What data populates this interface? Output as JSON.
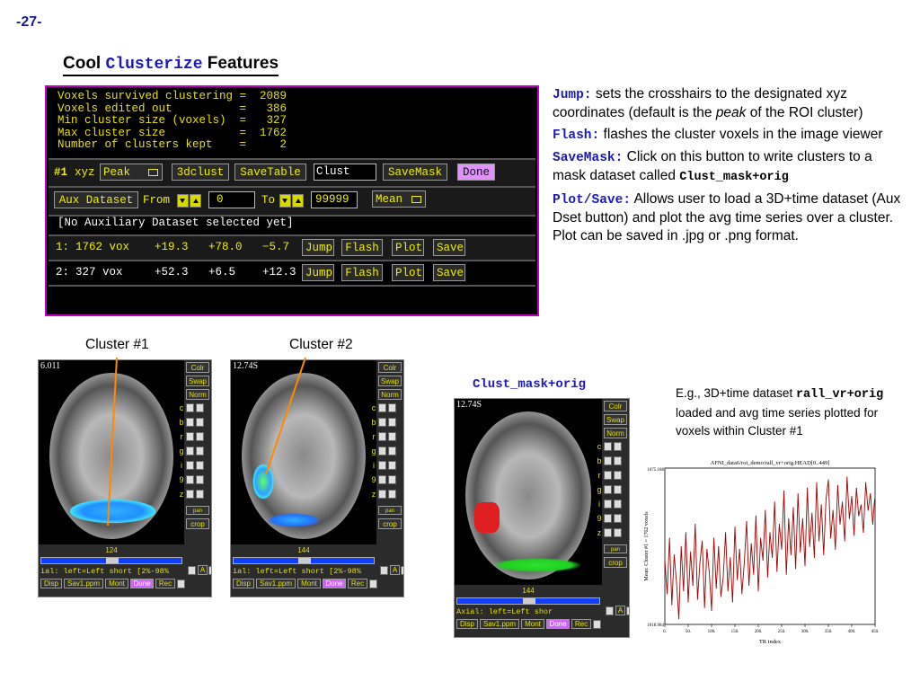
{
  "page_number": "-27-",
  "heading": {
    "pre": "Cool ",
    "code": "Clusterize",
    "post": " Features"
  },
  "panel": {
    "summary": [
      "Voxels survived clustering =  2089",
      "Voxels edited out          =   386",
      "Min cluster size (voxels)  =   327",
      "Max cluster size           =  1762",
      "Number of clusters kept    =     2"
    ],
    "row1": {
      "num": "#1",
      "xyz": "xyz",
      "peak": "Peak",
      "b3dclust": "3dclust",
      "savetable": "SaveTable",
      "prefix": "Clust",
      "savemask": "SaveMask",
      "done": "Done"
    },
    "row2": {
      "aux": "Aux Dataset",
      "from": "From",
      "from_val": "0",
      "to": "To",
      "to_val": "99999",
      "mean": "Mean"
    },
    "no_aux": "[No Auxiliary Dataset selected yet]",
    "clusters": [
      {
        "id": "1:",
        "vox": "1762 vox",
        "x": "+19.3",
        "y": "+78.0",
        "z": "−5.7"
      },
      {
        "id": "2:",
        "vox": "327 vox",
        "x": "+52.3",
        "y": "+6.5",
        "z": "+12.3"
      }
    ],
    "cluster_buttons": {
      "jump": "Jump",
      "flash": "Flash",
      "plot": "Plot",
      "save": "Save"
    }
  },
  "right_text": {
    "jump_kw": "Jump:",
    "jump_text": " sets the crosshairs to the designated xyz coordinates (default is the ",
    "jump_em": "peak",
    "jump_text2": " of the ROI cluster)",
    "flash_kw": "Flash:",
    "flash_text": " flashes the cluster voxels in the image viewer",
    "savemask_kw": "SaveMask:",
    "savemask_text": " Click on this button to write clusters to a mask dataset called ",
    "savemask_name": "Clust_mask+orig",
    "plotsave_kw": "Plot/Save:",
    "plotsave_text": " Allows user to load a 3D+time dataset (Aux Dset button) and plot the avg time series over a cluster. Plot can be saved in .jpg or .png format."
  },
  "captions": {
    "cluster1": "Cluster #1",
    "cluster2": "Cluster #2",
    "mask": "Clust_mask+orig"
  },
  "viewers": [
    {
      "label": "6.011",
      "slice": "124",
      "status": "ial: left=Left short [2%-98%",
      "a_btn": "A"
    },
    {
      "label": "12.74S",
      "slice": "144",
      "status": "ial: left=Left short [2%-98%",
      "a_btn": "A"
    },
    {
      "label": "12.74S",
      "slice": "144",
      "status": "Axial: left=Left shor",
      "a_btn": "A"
    }
  ],
  "viewer_side": {
    "colr": "Colr",
    "swap": "Swap",
    "norm": "Norm",
    "letters": [
      "c",
      "b",
      "r",
      "g",
      "i",
      "9",
      "z"
    ],
    "pan": "pan",
    "crop": "crop"
  },
  "viewer_bottom": {
    "disp": "Disp",
    "sav": "Sav1.ppm",
    "mont": "Mont",
    "done": "Done",
    "rec": "Rec"
  },
  "graph_caption": {
    "pre": "E.g., 3D+time dataset ",
    "code": "rall_vr+orig",
    "post": " loaded and avg time series plotted for voxels within Cluster #1"
  },
  "chart_data": {
    "type": "line",
    "title": "AFNI_data6/roi_demo/rall_vr+orig.HEAD[0..449]",
    "xlabel": "TR index",
    "ylabel": "Mean: Cluster #1 = 1762 voxels",
    "xlim": [
      0,
      450
    ],
    "ylim": [
      1018.984,
      1075.188
    ],
    "ytick_labels": [
      "1075.188",
      "1018.984"
    ],
    "xtick_labels": [
      "0.",
      "50.",
      "100.",
      "150.",
      "200.",
      "250.",
      "300.",
      "350.",
      "400.",
      "450."
    ],
    "series": [
      {
        "color": "#a00000",
        "x": [
          0,
          5,
          10,
          15,
          20,
          25,
          30,
          35,
          40,
          45,
          50,
          55,
          60,
          65,
          70,
          75,
          80,
          85,
          90,
          95,
          100,
          105,
          110,
          115,
          120,
          125,
          130,
          135,
          140,
          145,
          150,
          155,
          160,
          165,
          170,
          175,
          180,
          185,
          190,
          195,
          200,
          205,
          210,
          215,
          220,
          225,
          230,
          235,
          240,
          245,
          250,
          255,
          260,
          265,
          270,
          275,
          280,
          285,
          290,
          295,
          300,
          305,
          310,
          315,
          320,
          325,
          330,
          335,
          340,
          345,
          350,
          355,
          360,
          365,
          370,
          375,
          380,
          385,
          390,
          395,
          400,
          405,
          410,
          415,
          420,
          425,
          430,
          435,
          440,
          445,
          449
        ],
        "values": [
          1042,
          1030,
          1050,
          1026,
          1044,
          1034,
          1021,
          1047,
          1031,
          1052,
          1027,
          1045,
          1033,
          1055,
          1028,
          1041,
          1049,
          1025,
          1046,
          1038,
          1024,
          1050,
          1032,
          1047,
          1029,
          1036,
          1052,
          1031,
          1043,
          1027,
          1054,
          1035,
          1046,
          1030,
          1041,
          1056,
          1033,
          1048,
          1037,
          1058,
          1031,
          1050,
          1042,
          1060,
          1036,
          1052,
          1043,
          1063,
          1038,
          1055,
          1046,
          1067,
          1037,
          1057,
          1044,
          1061,
          1039,
          1066,
          1045,
          1057,
          1040,
          1068,
          1047,
          1059,
          1043,
          1070,
          1049,
          1062,
          1044,
          1064,
          1071,
          1050,
          1060,
          1046,
          1069,
          1055,
          1063,
          1049,
          1072,
          1057,
          1065,
          1051,
          1068,
          1058,
          1062,
          1052,
          1070,
          1060,
          1066,
          1055,
          1064
        ]
      }
    ]
  }
}
